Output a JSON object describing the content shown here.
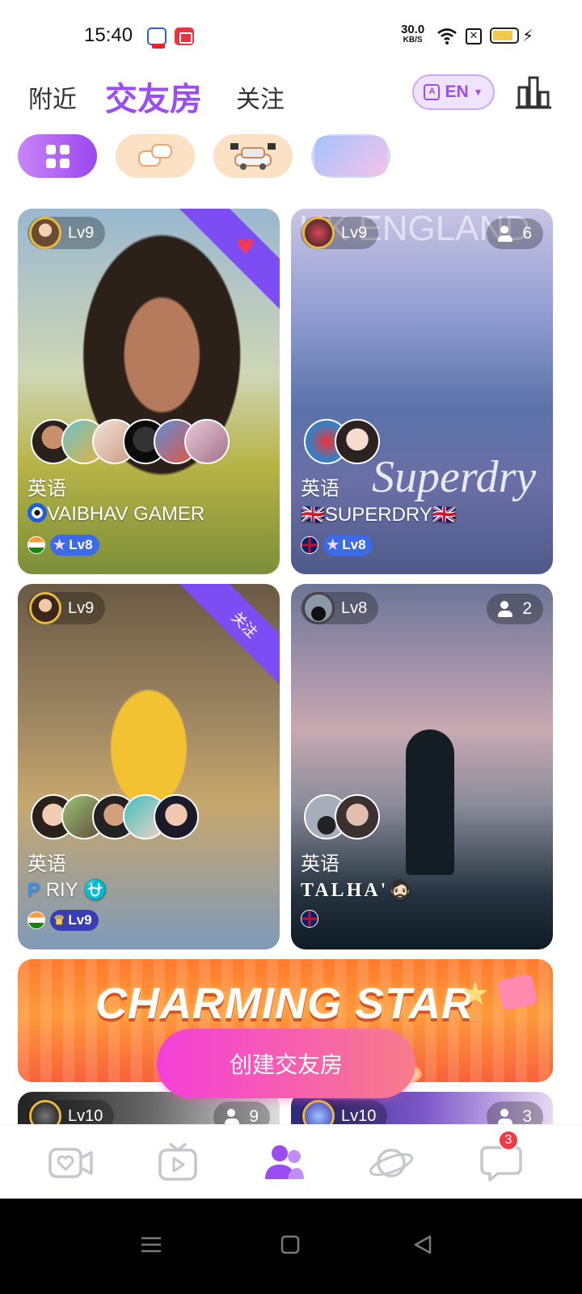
{
  "status_bar": {
    "time": "15:40",
    "net_speed_value": "30.0",
    "net_speed_unit": "KB/S",
    "sim_label": "✕",
    "battery_level": 0.85
  },
  "header": {
    "tabs": [
      {
        "label": "附近",
        "selected": false
      },
      {
        "label": "交友房",
        "selected": true
      },
      {
        "label": "关注",
        "selected": false
      }
    ],
    "language_button": "EN",
    "accent_color": "#9b4cf3"
  },
  "categories": [
    {
      "icon": "grid-icon",
      "selected": true
    },
    {
      "icon": "chat-bubbles-icon",
      "selected": false
    },
    {
      "icon": "race-car-icon",
      "selected": false
    },
    {
      "icon": "number-puzzle-icon",
      "selected": false
    }
  ],
  "rooms": [
    {
      "host_level": "Lv9",
      "corner_ribbon": "heart-wings-icon",
      "mic_avatars": 6,
      "language": "英语",
      "name": "VAIBHAV GAMER",
      "flag": "india-flag",
      "owner_level": "Lv8"
    },
    {
      "host_level": "Lv9",
      "member_count": "6",
      "background_text": "UK ENGLAND",
      "overlay_text": "Superdry",
      "mic_avatars": 2,
      "language": "英语",
      "name": "🇬🇧SUPERDRY🇬🇧",
      "flag": "uk-flag",
      "owner_level": "Lv8"
    },
    {
      "host_level": "Lv9",
      "corner_ribbon_text": "关注",
      "mic_avatars": 5,
      "language": "英语",
      "name": "RIY",
      "name_prefix": "P",
      "name_suffix": "⛎",
      "flag": "india-flag",
      "owner_level": "Lv9"
    },
    {
      "host_level": "Lv8",
      "member_count": "2",
      "mic_avatars": 2,
      "language": "英语",
      "name": "TALHA'🧔🏻",
      "flag": "uk-flag"
    }
  ],
  "banner": {
    "title": "CHARMING STAR"
  },
  "create_button": "创建交友房",
  "peek_rooms": [
    {
      "host_level": "Lv10",
      "member_count": "9"
    },
    {
      "host_level": "Lv10",
      "member_count": "3"
    }
  ],
  "bottom_nav": {
    "items": [
      {
        "icon": "live-video-icon",
        "selected": false
      },
      {
        "icon": "tv-play-icon",
        "selected": false
      },
      {
        "icon": "party-people-icon",
        "selected": true
      },
      {
        "icon": "planet-icon",
        "selected": false
      },
      {
        "icon": "messages-icon",
        "selected": false,
        "badge": "3"
      }
    ]
  }
}
